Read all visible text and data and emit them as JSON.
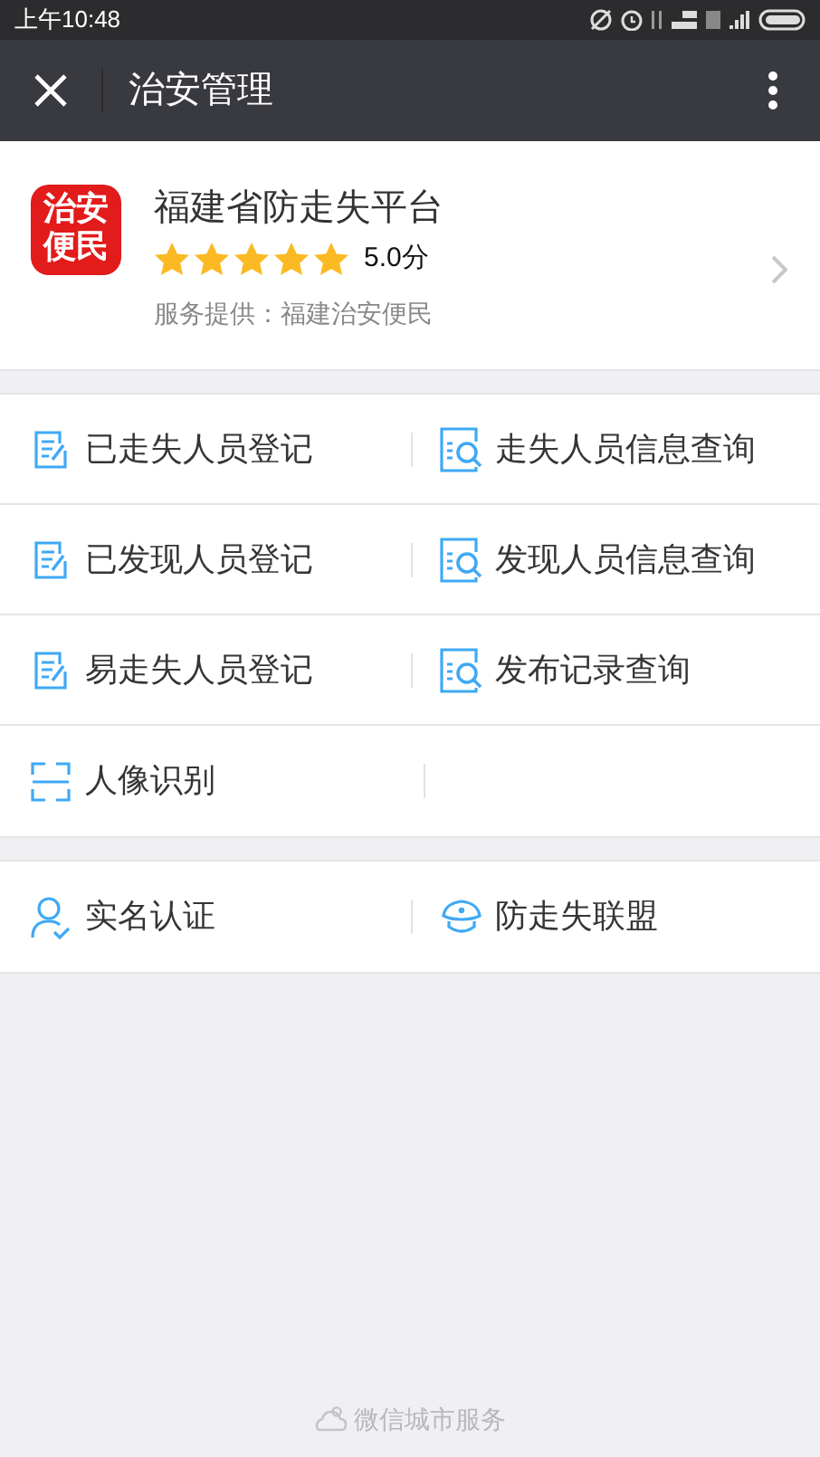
{
  "status_bar": {
    "time": "上午10:48"
  },
  "nav_bar": {
    "title": "治安管理"
  },
  "app_card": {
    "logo_text": "治安便民",
    "name": "福建省防走失平台",
    "stars": 5,
    "score": "5.0分",
    "provider": "服务提供：福建治安便民"
  },
  "menu": [
    {
      "kind": "edit",
      "label": "已走失人员登记"
    },
    {
      "kind": "search",
      "label": "走失人员信息查询"
    },
    {
      "kind": "edit",
      "label": "已发现人员登记"
    },
    {
      "kind": "search",
      "label": "发现人员信息查询"
    },
    {
      "kind": "edit",
      "label": "易走失人员登记"
    },
    {
      "kind": "search",
      "label": "发布记录查询"
    },
    {
      "kind": "scan",
      "label": "人像识别"
    }
  ],
  "menu_2": [
    {
      "kind": "user",
      "label": "实名认证"
    },
    {
      "kind": "cap",
      "label": "防走失联盟"
    }
  ],
  "footer": {
    "text": "微信城市服务"
  }
}
